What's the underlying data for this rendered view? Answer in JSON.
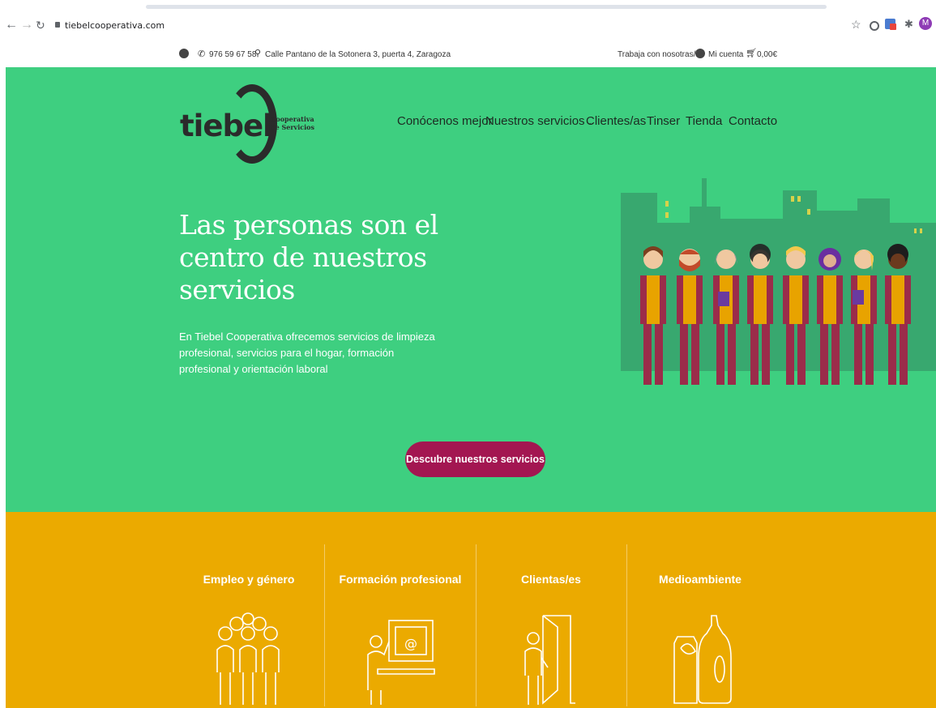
{
  "browser": {
    "url": "tiebelcooperativa.com",
    "avatar_letter": "M"
  },
  "topbar": {
    "phone": "976 59 67 58",
    "address": "Calle Pantano de la Sotonera 3, puerta 4, Zaragoza",
    "jobs_link": "Trabaja con nosotras/os",
    "account_link": "Mi cuenta",
    "cart_total": "0,00€"
  },
  "logo": {
    "name": "tiebel",
    "subtitle_line1": "Cooperativa",
    "subtitle_line2": "de Servicios"
  },
  "menu": {
    "items": [
      "Conócenos mejor",
      "Nuestros servicios",
      "Clientes/as",
      "Tinser",
      "Tienda",
      "Contacto"
    ]
  },
  "hero": {
    "title": "Las personas son el centro de nuestros servicios",
    "description": "En Tiebel Cooperativa ofrecemos servicios de limpieza profesional, servicios para el hogar, formación profesional y orientación laboral",
    "cta_label": "Descubre nuestros servicios"
  },
  "categories": [
    {
      "title": "Empleo y género",
      "icon": "people-group-icon"
    },
    {
      "title": "Formación profesional",
      "icon": "teacher-screen-icon"
    },
    {
      "title": "Clientas/es",
      "icon": "person-door-icon"
    },
    {
      "title": "Medioambiente",
      "icon": "cleaning-bottles-icon"
    }
  ],
  "colors": {
    "hero_green": "#3ecf80",
    "cta_magenta": "#a31651",
    "section_yellow": "#ebaa00"
  }
}
